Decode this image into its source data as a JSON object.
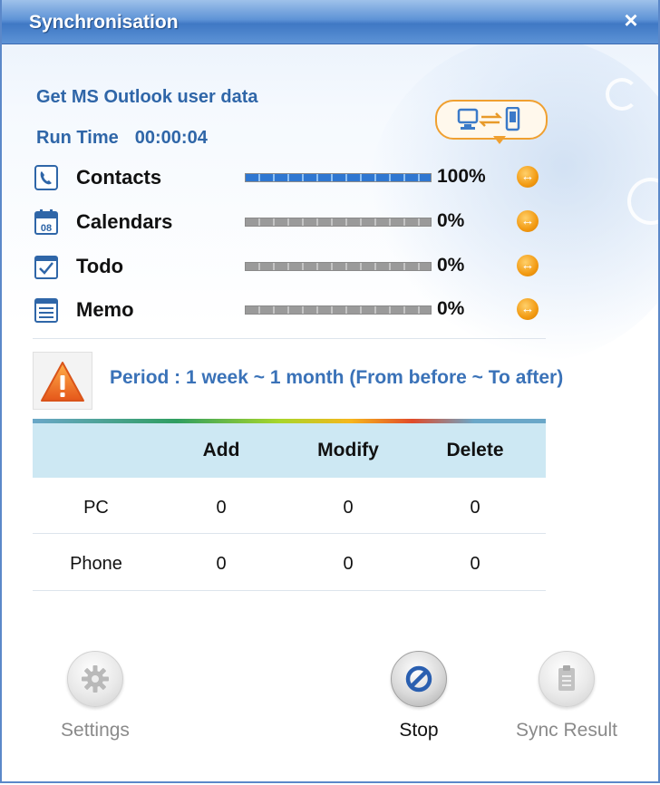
{
  "window": {
    "title": "Synchronisation",
    "close_symbol": "×"
  },
  "status": {
    "message": "Get MS Outlook user data",
    "runtime_label": "Run Time",
    "runtime_value": "00:00:04"
  },
  "sync_icon": "pc-phone-sync-icon",
  "categories": [
    {
      "name": "Contacts",
      "percent_text": "100%",
      "progress": 1.0,
      "icon": "contacts-icon"
    },
    {
      "name": "Calendars",
      "percent_text": "0%",
      "progress": 0.0,
      "icon": "calendar-icon"
    },
    {
      "name": "Todo",
      "percent_text": "0%",
      "progress": 0.0,
      "icon": "todo-icon"
    },
    {
      "name": "Memo",
      "percent_text": "0%",
      "progress": 0.0,
      "icon": "memo-icon"
    }
  ],
  "calendar_icon_day": "08",
  "period": {
    "text": "Period : 1 week ~ 1 month (From before ~ To after)",
    "icon": "warning-icon"
  },
  "table": {
    "headers": [
      "",
      "Add",
      "Modify",
      "Delete"
    ],
    "rows": [
      {
        "name": "PC",
        "add": "0",
        "modify": "0",
        "delete": "0"
      },
      {
        "name": "Phone",
        "add": "0",
        "modify": "0",
        "delete": "0"
      }
    ]
  },
  "buttons": {
    "settings": "Settings",
    "stop": "Stop",
    "sync_result": "Sync Result"
  },
  "colors": {
    "title_bar": "#5e93d6",
    "status_text": "#2f66a8",
    "progress_fill": "#2f77d1",
    "direction_badge": "#f29a12",
    "warning": "#f07a1e",
    "table_header": "#cde8f3",
    "stop_icon": "#2a5fb0"
  }
}
